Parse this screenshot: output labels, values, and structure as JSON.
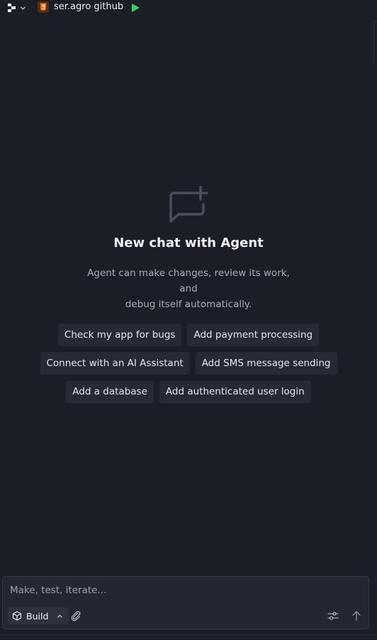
{
  "header": {
    "app_name": "ser.agro github",
    "workspace_icon": "workspace-logo-icon",
    "app_icon": "html5-icon",
    "run_icon": "play-icon"
  },
  "empty_state": {
    "title": "New chat with Agent",
    "description_line1": "Agent can make changes, review its work, and",
    "description_line2": "debug itself automatically.",
    "icon": "chat-plus-icon"
  },
  "suggestions": [
    [
      "Check my app for bugs",
      "Add payment processing"
    ],
    [
      "Connect with an AI Assistant",
      "Add SMS message sending"
    ],
    [
      "Add a database",
      "Add authenticated user login"
    ]
  ],
  "composer": {
    "placeholder": "Make, test, iterate...",
    "value": "",
    "mode_label": "Build"
  },
  "colors": {
    "background": "#1b1e26",
    "chip": "#272a34",
    "run_green": "#3fcf5e",
    "html_orange": "#e06a1b"
  }
}
